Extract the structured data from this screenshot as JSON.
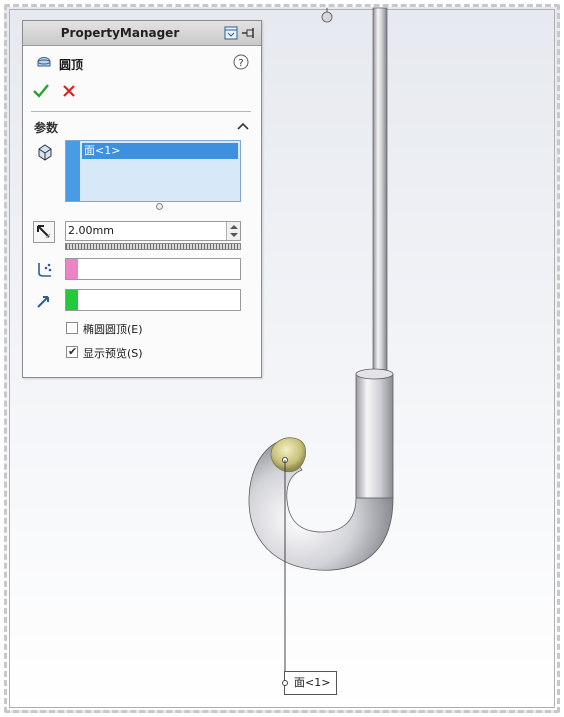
{
  "property_manager": {
    "title": "PropertyManager",
    "feature_name": "圆顶",
    "section_title": "参数",
    "selection": {
      "items": [
        "面<1>"
      ],
      "face_color": "#4a9be6"
    },
    "distance": {
      "value": "2.00mm"
    },
    "constraint_color": "#ee82c6",
    "direction_color": "#22c93a",
    "options": {
      "elliptical_dome": {
        "label": "椭圆圆顶(E)",
        "checked": false
      },
      "show_preview": {
        "label": "显示预览(S)",
        "checked": true
      }
    }
  },
  "graphics": {
    "callout_label": "面<1>",
    "model_color": "#b8b8c0",
    "dome_preview_color": "#c9c27a"
  },
  "icons": {
    "header": [
      "pin-icon",
      "window-icon"
    ],
    "ok": "checkmark-icon",
    "cancel": "x-icon",
    "help": "question-icon",
    "feature": "dome-icon",
    "face": "face-icon",
    "distance": "distance-arrow-icon",
    "constraint": "constraint-icon",
    "direction": "direction-arrow-icon"
  }
}
